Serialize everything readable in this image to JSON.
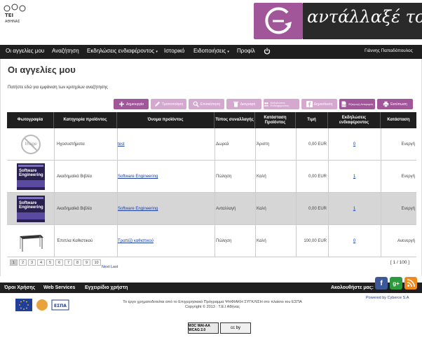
{
  "header": {
    "tei_logo_text": "ΤΕΙ ΑΘΗΝΑΣ",
    "brand_text": "αντάλλαξέ το!",
    "accent": "#a2569a"
  },
  "nav": {
    "items": [
      "Οι αγγελίες μου",
      "Αναζήτηση",
      "Εκδηλώσεις ενδιαφέροντος",
      "Ιστορικό",
      "Ειδοποιήσεις",
      "Προφίλ"
    ],
    "user": "Γιάννης Παπαδόπουλος"
  },
  "page": {
    "title": "Οι αγγελίες μου",
    "search_hint": "Πατήστε εδώ για εμφάνιση των κριτηρίων αναζήτησης"
  },
  "toolbar": [
    {
      "label": "Δημιουργία",
      "icon": "plus-icon",
      "state": "active"
    },
    {
      "label": "Τροποποίηση",
      "icon": "pencil-icon",
      "state": "disabled"
    },
    {
      "label": "Επισκόπηση",
      "icon": "magnifier-icon",
      "state": "disabled"
    },
    {
      "label": "Διαγραφή",
      "icon": "trash-icon",
      "state": "disabled"
    },
    {
      "label": "Εκδηλώσεις Ενδιαφέροντος",
      "icon": "people-icon",
      "state": "disabled"
    },
    {
      "label": "Δημοσίευση",
      "icon": "facebook-icon",
      "state": "disabled"
    },
    {
      "label": "Εξαγωγή Αναφοράς",
      "icon": "pdf-icon",
      "state": "active"
    },
    {
      "label": "Εκτύπωση",
      "icon": "printer-icon",
      "state": "active"
    }
  ],
  "table": {
    "headers": [
      "Φωτογραφία",
      "Κατηγορία προϊόντος",
      "Όνομα προϊόντος",
      "Τύπος συναλλαγής",
      "Κατάσταση Προϊόντος",
      "Τιμή",
      "Εκδηλώσεις ενδιαφέροντος",
      "Κατάσταση"
    ],
    "rows": [
      {
        "thumb": "no-image",
        "thumb_text": "Image",
        "category": "Ηχοσυστήματα",
        "name": "test",
        "type": "Δωρεά",
        "condition": "Άριστη",
        "price": "0,00 EUR",
        "interest": "0",
        "status": "Ενεργή"
      },
      {
        "thumb": "book",
        "thumb_text": "Software Engineering",
        "category": "Ακαδημαϊκά Βιβλία",
        "name": "Software Engineering",
        "type": "Πώληση",
        "condition": "Καλή",
        "price": "0,00 EUR",
        "interest": "1",
        "status": "Ενεργή"
      },
      {
        "thumb": "book",
        "thumb_text": "Software Engineering",
        "category": "Ακαδημαϊκά Βιβλία",
        "name": "Software Engineering",
        "type": "Ανταλλαγή",
        "condition": "Καλή",
        "price": "0,00 EUR",
        "interest": "1",
        "status": "Ενεργή"
      },
      {
        "thumb": "desk",
        "thumb_text": "",
        "category": "Έπιπλα Καθιστικού",
        "name": "Τραπέζι καθιστικού",
        "type": "Πώληση",
        "condition": "Καλή",
        "price": "100,00 EUR",
        "interest": "0",
        "status": "Ανενεργή"
      }
    ]
  },
  "pager": {
    "pages": [
      "1",
      "2",
      "3",
      "4",
      "5",
      "6",
      "7",
      "8",
      "9",
      "10"
    ],
    "next": "Next Last",
    "count": "[ 1 / 100 ]"
  },
  "footer": {
    "links": [
      "Όροι Χρήσης",
      "Web Services",
      "Εγχειρίδιο χρήστη"
    ],
    "follow": "Ακολουθήστε μας:",
    "line1": "Το έργο χρηματοδοτείται από το Επιχειρησιακό Πρόγραμμα ΨΗΦΙΑΚΗ ΣΥΓΚΛΙΣΗ στο πλαίσιο του ΕΣΠΑ",
    "line2": "Copyright © 2013 : Τ.Ε.Ι Αθήνας",
    "powered": "Powered by Cyberce S.A",
    "espa": "ΕΣΠΑ",
    "wcag": "W3C WAI-AA WCAG 2.0",
    "cc": "cc by"
  }
}
